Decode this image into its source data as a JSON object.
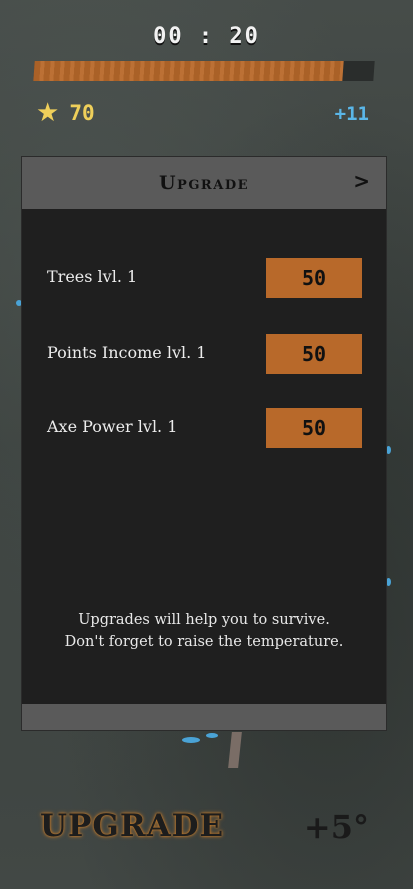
{
  "hud": {
    "timer": "00 : 20",
    "progress_fraction": 0.91,
    "score": "70",
    "income": "+11"
  },
  "panel": {
    "title": "Upgrade",
    "rows": [
      {
        "label": "Trees lvl. 1",
        "price": "50"
      },
      {
        "label": "Points Income lvl. 1",
        "price": "50"
      },
      {
        "label": "Axe Power lvl. 1",
        "price": "50"
      }
    ],
    "hint_line1": "Upgrades will help you to survive.",
    "hint_line2": "Don't forget to raise the temperature."
  },
  "bottom": {
    "upgrade_label": "UPGRADE",
    "temperature": "+5°"
  },
  "colors": {
    "accent": "#b8692a",
    "star": "#efcf5a",
    "income": "#5ab6e8",
    "panel": "#1f1f1f",
    "panel_bar": "#5a5a5a"
  },
  "icons": {
    "score": "star-icon",
    "next": "chevron-right-icon"
  }
}
